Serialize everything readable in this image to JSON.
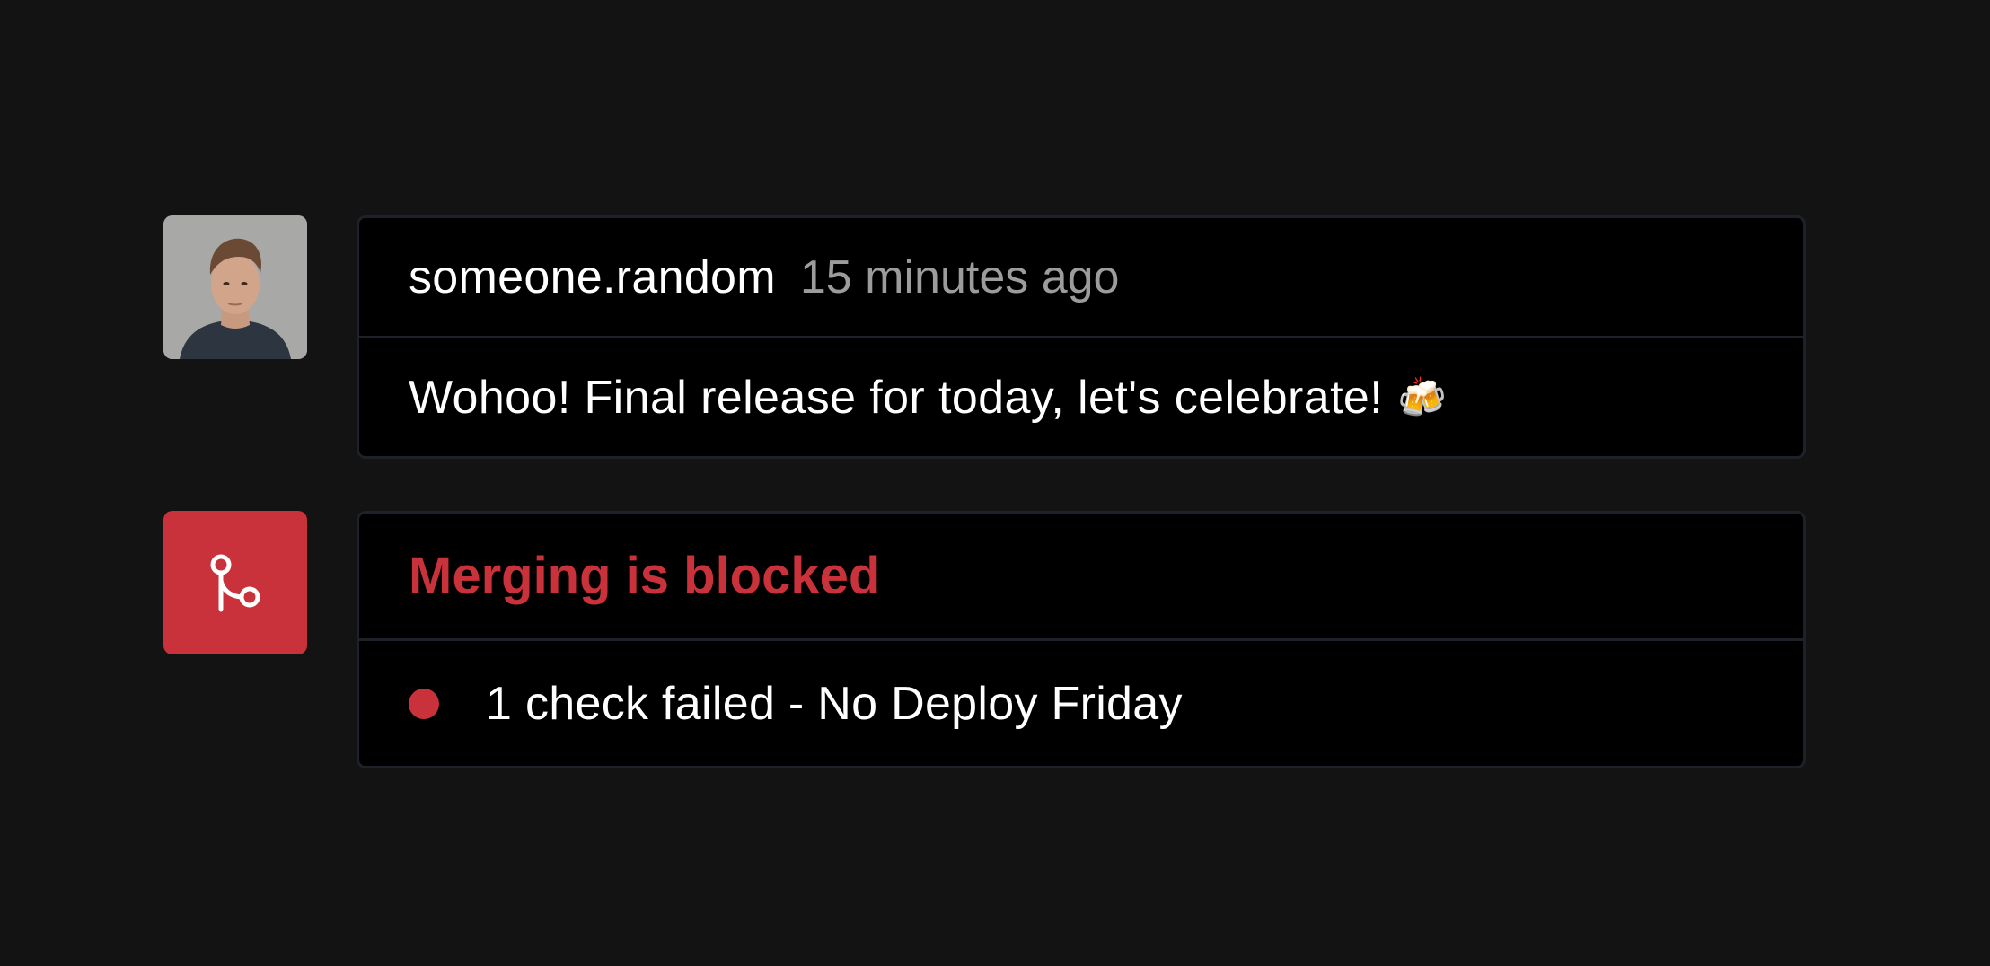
{
  "comment": {
    "avatar_icon": "user-avatar-photo",
    "username": "someone.random",
    "timestamp": "15 minutes ago",
    "message": "Wohoo! Final release for today, let's celebrate!",
    "emoji": "🍻"
  },
  "merge_status": {
    "icon": "git-merge-icon",
    "title": "Merging is blocked",
    "check_text": "1 check failed - No Deploy Friday",
    "status_color": "#c9323a"
  }
}
